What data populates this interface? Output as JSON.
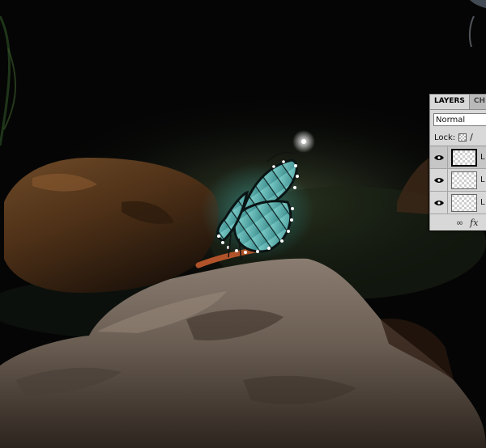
{
  "layers_panel": {
    "tabs": [
      {
        "label": "LAYERS",
        "active": true
      },
      {
        "label": "CH",
        "active": false
      }
    ],
    "blend_mode": "Normal",
    "lock_label": "Lock:",
    "layers": [
      {
        "name": "L",
        "visible": true,
        "selected": true
      },
      {
        "name": "L",
        "visible": true,
        "selected": false
      },
      {
        "name": "L",
        "visible": true,
        "selected": false
      }
    ],
    "footer_fx": "fx"
  },
  "colors": {
    "panel_bg": "#d8d8d8",
    "butterfly_wing": "#5fb0b0",
    "butterfly_glow": "#2ea3a6",
    "rock_left": "#5b3a1c",
    "rock_front": "#6e625a"
  }
}
